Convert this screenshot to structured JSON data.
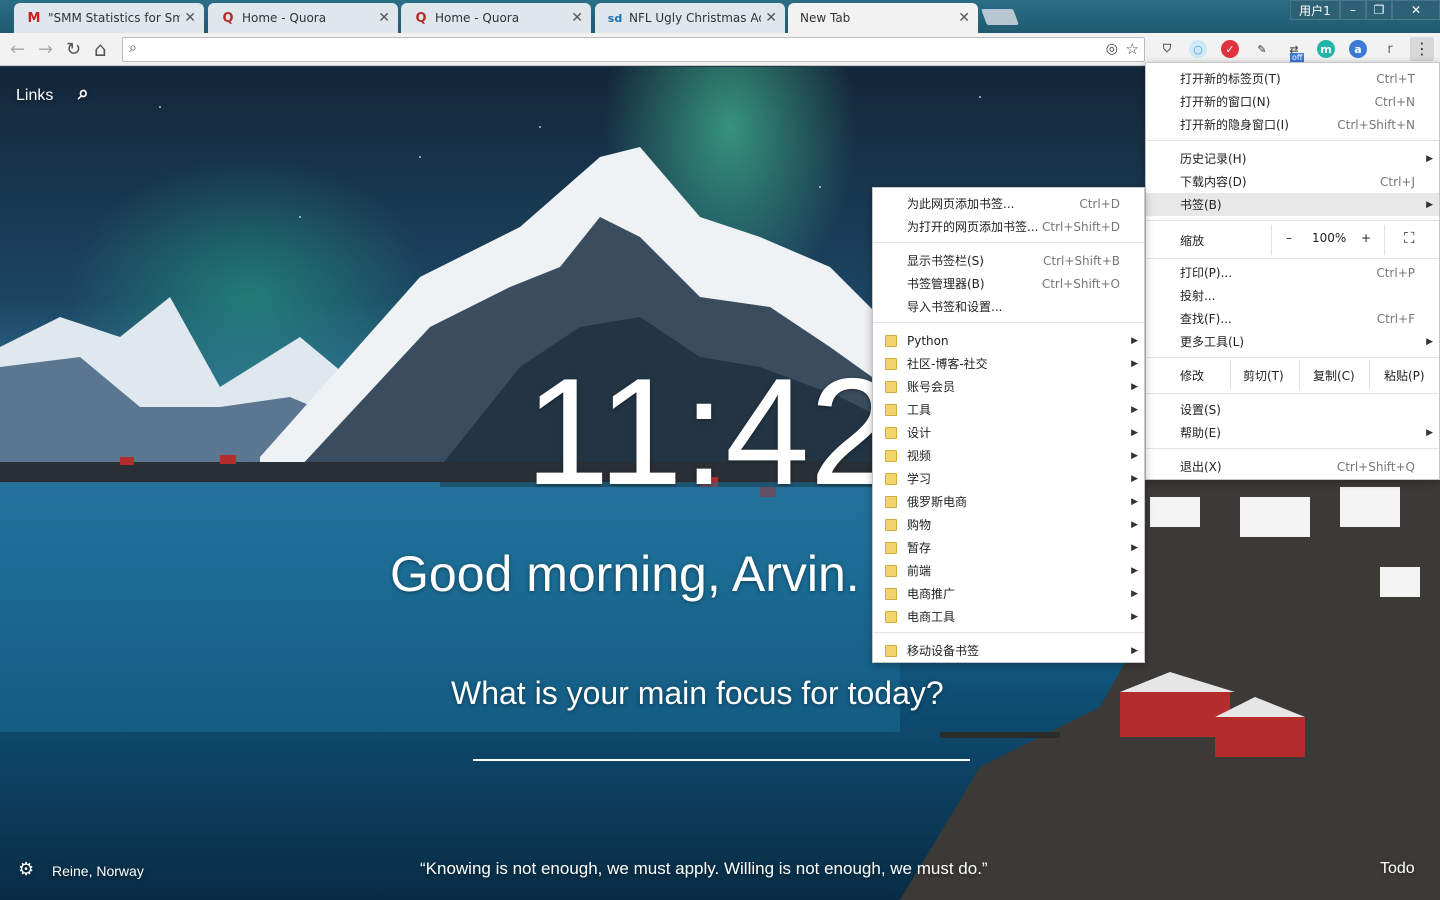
{
  "tabs": [
    {
      "title": "\"SMM Statistics for Sm",
      "icon": "gmail-icon",
      "color": "#c5221f",
      "glyph": "M"
    },
    {
      "title": "Home - Quora",
      "icon": "quora-icon",
      "color": "#b92b27",
      "glyph": "Q"
    },
    {
      "title": "Home - Quora",
      "icon": "quora-icon",
      "color": "#b92b27",
      "glyph": "Q"
    },
    {
      "title": "NFL Ugly Christmas Ad",
      "icon": "sd-icon",
      "color": "#1a6fb5",
      "glyph": "sd"
    },
    {
      "title": "New Tab",
      "icon": "",
      "color": "",
      "glyph": ""
    }
  ],
  "window": {
    "user": "用户1",
    "minimize": "–",
    "restore": "❐",
    "close": "✕"
  },
  "toolbar": {
    "back": "←",
    "forward": "→",
    "reload": "↻",
    "home": "⌂",
    "search_icon": "⌕",
    "url": "",
    "extensions": [
      {
        "name": "ublock-icon",
        "color": "#555",
        "glyph": "⛉"
      },
      {
        "name": "circle-ext-icon",
        "color": "#7fc4ef",
        "glyph": "○"
      },
      {
        "name": "pocket-icon",
        "color": "#e0333f",
        "glyph": "✓"
      },
      {
        "name": "evernote-icon",
        "color": "#333",
        "glyph": "✎"
      },
      {
        "name": "off-ext-icon",
        "color": "#555",
        "glyph": "⇄"
      },
      {
        "name": "m-ext-icon",
        "color": "#21b6a8",
        "glyph": "m"
      },
      {
        "name": "a-ext-icon",
        "color": "#3c7ad6",
        "glyph": "a"
      },
      {
        "name": "r-ext-icon",
        "color": "#777",
        "glyph": "r"
      }
    ],
    "menu": "⋮"
  },
  "momentum": {
    "links": "Links",
    "time": "11:42",
    "greeting": "Good morning, Arvin.",
    "focus": "What is your main focus for today?",
    "location": "Reine, Norway",
    "quote": "“Knowing is not enough, we must apply. Willing is not enough, we must do.”",
    "todo": "Todo"
  },
  "chrome_menu": {
    "new_tab": {
      "label": "打开新的标签页(T)",
      "sc": "Ctrl+T"
    },
    "new_window": {
      "label": "打开新的窗口(N)",
      "sc": "Ctrl+N"
    },
    "incognito": {
      "label": "打开新的隐身窗口(I)",
      "sc": "Ctrl+Shift+N"
    },
    "history": {
      "label": "历史记录(H)"
    },
    "downloads": {
      "label": "下载内容(D)",
      "sc": "Ctrl+J"
    },
    "bookmarks": {
      "label": "书签(B)"
    },
    "zoom": {
      "label": "缩放",
      "minus": "–",
      "value": "100%",
      "plus": "+"
    },
    "print": {
      "label": "打印(P)...",
      "sc": "Ctrl+P"
    },
    "cast": {
      "label": "投射..."
    },
    "find": {
      "label": "查找(F)...",
      "sc": "Ctrl+F"
    },
    "more_tools": {
      "label": "更多工具(L)"
    },
    "edit": {
      "label": "修改",
      "cut": "剪切(T)",
      "copy": "复制(C)",
      "paste": "粘贴(P)"
    },
    "settings": {
      "label": "设置(S)"
    },
    "help": {
      "label": "帮助(E)"
    },
    "exit": {
      "label": "退出(X)",
      "sc": "Ctrl+Shift+Q"
    }
  },
  "bookmark_menu": {
    "add_page": {
      "label": "为此网页添加书签...",
      "sc": "Ctrl+D"
    },
    "add_open": {
      "label": "为打开的网页添加书签...",
      "sc": "Ctrl+Shift+D"
    },
    "show_bar": {
      "label": "显示书签栏(S)",
      "sc": "Ctrl+Shift+B"
    },
    "manager": {
      "label": "书签管理器(B)",
      "sc": "Ctrl+Shift+O"
    },
    "import": {
      "label": "导入书签和设置..."
    },
    "folders": [
      "Python",
      "社区-博客-社交",
      "账号会员",
      "工具",
      "设计",
      "视频",
      "学习",
      "俄罗斯电商",
      "购物",
      "暂存",
      "前端",
      "电商推广",
      "电商工具"
    ],
    "mobile": "移动设备书签"
  }
}
